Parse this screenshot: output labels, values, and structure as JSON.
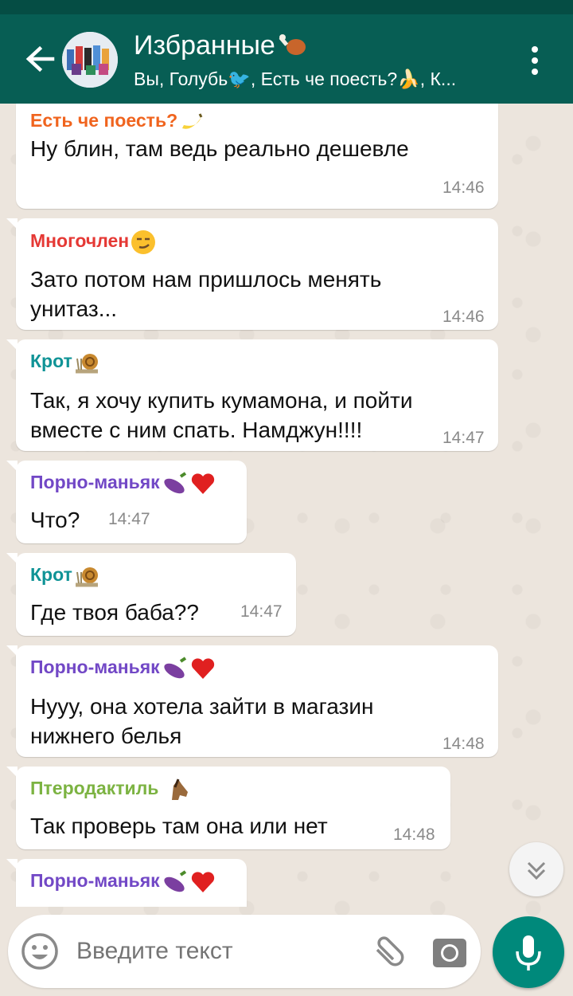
{
  "colors": {
    "header": "#075e54",
    "accent": "#00897b"
  },
  "header": {
    "title": "Избранные",
    "title_emoji_icon": "poultry-leg-icon",
    "subtitle": "Вы, Голубь🐦, Есть че поесть?🍌, К...",
    "back_icon": "arrow-left-icon",
    "menu_icon": "more-vertical-icon"
  },
  "messages": [
    {
      "sender": "Есть че поесть?",
      "sender_color": "#f0641e",
      "sender_emoji": "🍌",
      "lines": [
        "Ну блин, там ведь реально дешевле"
      ],
      "time": "14:46"
    },
    {
      "sender": "Многочлен",
      "sender_color": "#e53935",
      "sender_emoji": "😏",
      "lines": [
        "Зато потом нам пришлось менять",
        "унитаз..."
      ],
      "time": "14:46"
    },
    {
      "sender": "Крот",
      "sender_color": "#0f9396",
      "sender_emoji": "🐌",
      "lines": [
        "Так, я хочу купить кумамона, и пойти",
        "вместе с ним спать. Намджун!!!!"
      ],
      "time": "14:47"
    },
    {
      "sender": "Порно-маньяк",
      "sender_color": "#7248c6",
      "sender_emoji": "🍆❤️",
      "lines": [
        "Что?"
      ],
      "time": "14:47"
    },
    {
      "sender": "Крот",
      "sender_color": "#0f9396",
      "sender_emoji": "🐌",
      "lines": [
        "Где твоя баба??"
      ],
      "time": "14:47"
    },
    {
      "sender": "Порно-маньяк",
      "sender_color": "#7248c6",
      "sender_emoji": "🍆❤️",
      "lines": [
        "Нууу, она хотела зайти в магазин",
        "нижнего белья"
      ],
      "time": "14:48"
    },
    {
      "sender": "Птеродактиль",
      "sender_color": "#7cb342",
      "sender_emoji": "🐴",
      "lines": [
        "Так проверь там она или нет"
      ],
      "time": "14:48"
    },
    {
      "sender": "Порно-маньяк",
      "sender_color": "#7248c6",
      "sender_emoji": "🍆❤️",
      "lines": [],
      "time": ""
    }
  ],
  "composer": {
    "placeholder": "Введите текст",
    "emoji_icon": "smiley-icon",
    "attach_icon": "paperclip-icon",
    "camera_icon": "camera-icon",
    "mic_icon": "microphone-icon",
    "scroll_icon": "double-chevron-down-icon"
  }
}
